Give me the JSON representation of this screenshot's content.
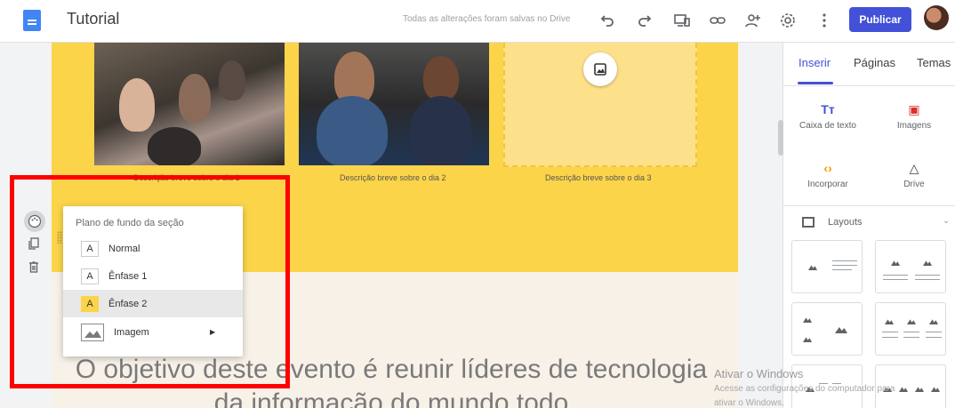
{
  "header": {
    "doc_title": "Tutorial",
    "save_status": "Todas as alterações foram salvas no Drive",
    "publish_label": "Publicar"
  },
  "page": {
    "captions": [
      "Descrição breve sobre o dia 1",
      "Descrição breve sobre o dia 2",
      "Descrição breve sobre o dia 3"
    ],
    "heading_line1": "O objetivo deste evento é reunir líderes de tecnologia",
    "heading_line2": "da informação do mundo todo"
  },
  "popup": {
    "title": "Plano de fundo da seção",
    "options": [
      {
        "swatch": "A",
        "label": "Normal"
      },
      {
        "swatch": "A",
        "label": "Ênfase 1"
      },
      {
        "swatch": "A",
        "label": "Ênfase 2",
        "selected": true
      },
      {
        "swatch": "",
        "label": "Imagem"
      }
    ]
  },
  "panel": {
    "tabs": [
      "Inserir",
      "Páginas",
      "Temas"
    ],
    "active_tab": "Inserir",
    "insert_items": [
      {
        "icon": "text-box-icon",
        "glyph": "Tт",
        "label": "Caixa de texto"
      },
      {
        "icon": "images-icon",
        "glyph": "▣",
        "label": "Imagens"
      },
      {
        "icon": "embed-icon",
        "glyph": "‹›",
        "label": "Incorporar"
      },
      {
        "icon": "drive-icon",
        "glyph": "△",
        "label": "Drive"
      }
    ],
    "layouts_label": "Layouts"
  },
  "watermark": {
    "title": "Ativar o Windows",
    "line1": "Acesse as configurações do computador para",
    "line2": "ativar o Windows."
  },
  "colors": {
    "accent": "#4351d8",
    "section_yellow": "#fbd449",
    "highlight_red": "#ff0000"
  }
}
